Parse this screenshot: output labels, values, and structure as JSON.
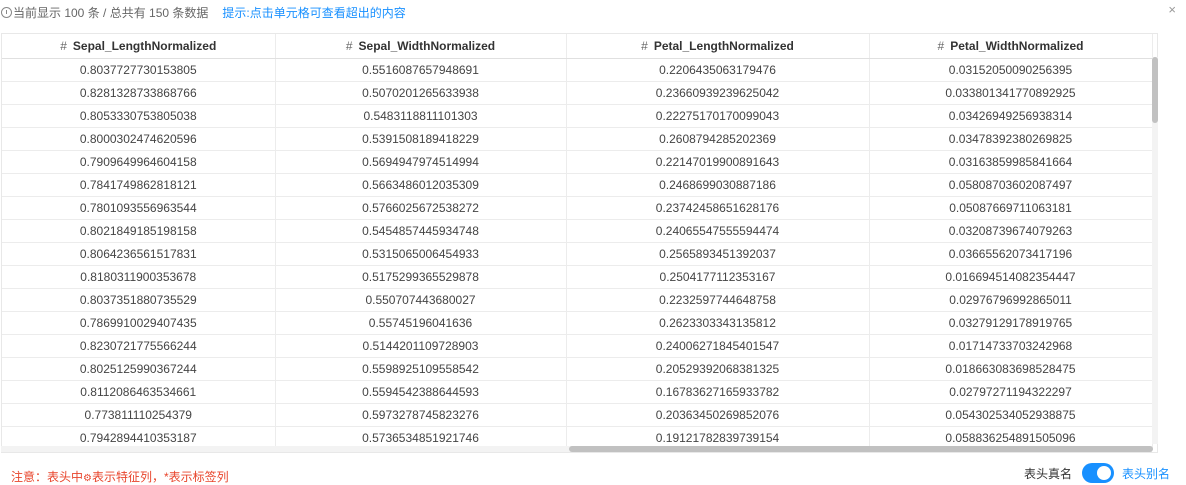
{
  "topbar": {
    "count_text": "当前显示 100 条 / 总共有 150 条数据",
    "tip_text": "提示:点击单元格可查看超出的内容",
    "close_glyph": "×"
  },
  "table": {
    "columns": [
      {
        "hash": "#",
        "name": "Sepal_LengthNormalized"
      },
      {
        "hash": "#",
        "name": "Sepal_WidthNormalized"
      },
      {
        "hash": "#",
        "name": "Petal_LengthNormalized"
      },
      {
        "hash": "#",
        "name": "Petal_WidthNormalized"
      }
    ],
    "rows": [
      [
        "0.8037727730153805",
        "0.5516087657948691",
        "0.2206435063179476",
        "0.03152050090256395"
      ],
      [
        "0.8281328733868766",
        "0.5070201265633938",
        "0.23660939239625042",
        "0.033801341770892925"
      ],
      [
        "0.8053330753805038",
        "0.5483118811101303",
        "0.22275170170099043",
        "0.03426949256938314"
      ],
      [
        "0.8000302474620596",
        "0.5391508189418229",
        "0.2608794285202369",
        "0.03478392380269825"
      ],
      [
        "0.7909649964604158",
        "0.5694947974514994",
        "0.22147019900891643",
        "0.03163859985841664"
      ],
      [
        "0.7841749862818121",
        "0.5663486012035309",
        "0.2468699030887186",
        "0.05808703602087497"
      ],
      [
        "0.7801093556963544",
        "0.5766025672538272",
        "0.23742458651628176",
        "0.05087669711063181"
      ],
      [
        "0.8021849185198158",
        "0.5454857445934748",
        "0.24065547555594474",
        "0.03208739674079263"
      ],
      [
        "0.8064236561517831",
        "0.5315065006454933",
        "0.2565893451392037",
        "0.03665562073417196"
      ],
      [
        "0.8180311900353678",
        "0.5175299365529878",
        "0.2504177112353167",
        "0.016694514082354447"
      ],
      [
        "0.8037351880735529",
        "0.550707443680027",
        "0.2232597744648758",
        "0.02976796992865011"
      ],
      [
        "0.7869910029407435",
        "0.55745196041636",
        "0.2623303343135812",
        "0.03279129178919765"
      ],
      [
        "0.8230721775566244",
        "0.5144201109728903",
        "0.24006271845401547",
        "0.01714733703242968"
      ],
      [
        "0.8025125990367244",
        "0.5598925109558542",
        "0.20529392068381325",
        "0.018663083698528475"
      ],
      [
        "0.8112086463534661",
        "0.5594542388644593",
        "0.16783627165933782",
        "0.02797271194322297"
      ],
      [
        "0.773811110254379",
        "0.5973278745823276",
        "0.20363450269852076",
        "0.054302534052938875"
      ],
      [
        "0.7942894410353187",
        "0.5736534851921746",
        "0.19121782839739154",
        "0.058836254891505096"
      ]
    ]
  },
  "footer": {
    "note_prefix": "注意：表头中",
    "note_gear": "⚙",
    "note_suffix": "表示特征列，*表示标签列",
    "real_name_label": "表头真名",
    "alias_label": "表头别名",
    "toggle_on": true,
    "toggle_color": "#1890ff"
  }
}
